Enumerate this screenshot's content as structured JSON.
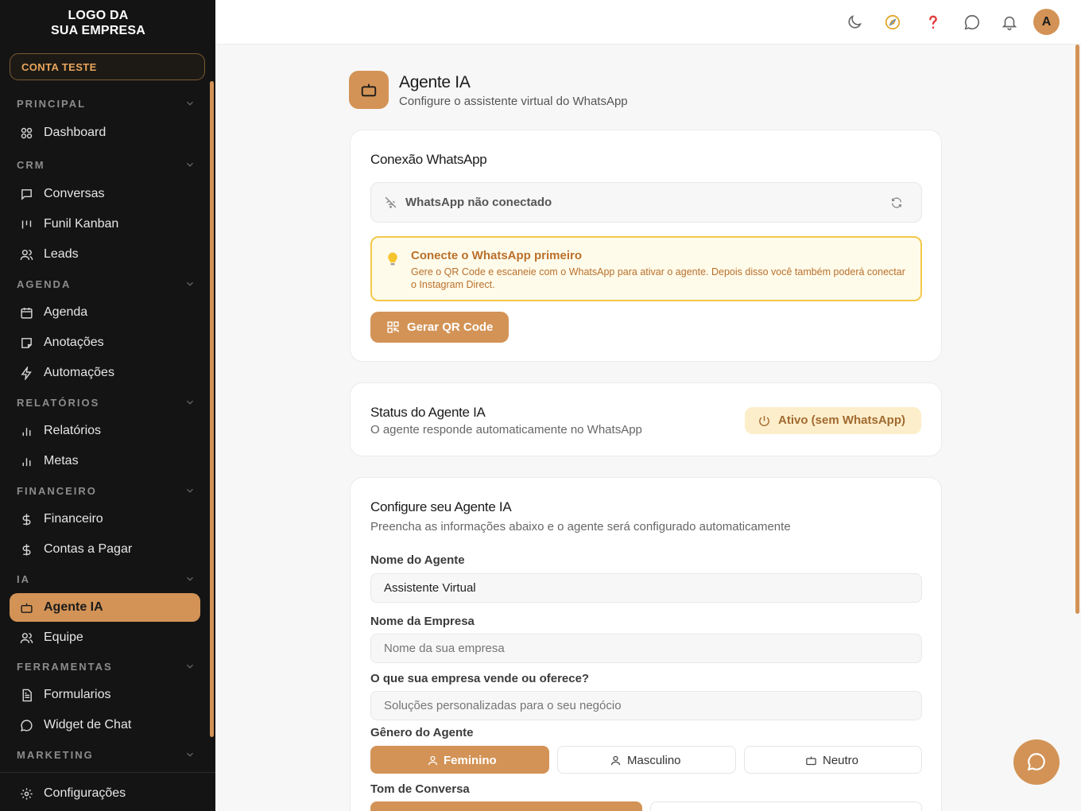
{
  "brand": {
    "logo_line1": "LOGO DA",
    "logo_line2": "SUA EMPRESA",
    "account": "CONTA TESTE",
    "accent": "#d39356"
  },
  "sidebar": {
    "sections": {
      "principal": "PRINCIPAL",
      "crm": "CRM",
      "agenda": "AGENDA",
      "relatorios": "RELATÓRIOS",
      "financeiro": "FINANCEIRO",
      "ia": "IA",
      "ferramentas": "FERRAMENTAS",
      "marketing": "MARKETING"
    },
    "items": {
      "dashboard": "Dashboard",
      "conversas": "Conversas",
      "funil": "Funil Kanban",
      "leads": "Leads",
      "agenda": "Agenda",
      "anotacoes": "Anotações",
      "automacoes": "Automações",
      "relatorios": "Relatórios",
      "metas": "Metas",
      "financeiro": "Financeiro",
      "contas": "Contas a Pagar",
      "agente": "Agente IA",
      "equipe": "Equipe",
      "formularios": "Formularios",
      "widget": "Widget de Chat",
      "configuracoes": "Configurações"
    },
    "active_item": "Agente IA"
  },
  "topbar": {
    "icons": [
      "moon-icon",
      "compass-icon",
      "help-icon",
      "message-icon",
      "bell-icon"
    ],
    "avatar_initial": "A"
  },
  "page": {
    "title": "Agente IA",
    "subtitle": "Configure o assistente virtual do WhatsApp"
  },
  "whatsapp": {
    "title": "Conexão WhatsApp",
    "status": "WhatsApp não conectado",
    "alert_title": "Conecte o WhatsApp primeiro",
    "alert_text": "Gere o QR Code e escaneie com o WhatsApp para ativar o agente. Depois disso você também poderá conectar o Instagram Direct.",
    "button": "Gerar QR Code"
  },
  "agent_status": {
    "title": "Status do Agente IA",
    "subtitle": "O agente responde automaticamente no WhatsApp",
    "badge": "Ativo (sem WhatsApp)"
  },
  "config": {
    "title": "Configure seu Agente IA",
    "subtitle": "Preencha as informações abaixo e o agente será configurado automaticamente",
    "agent_name_label": "Nome do Agente",
    "agent_name_value": "Assistente Virtual",
    "company_label": "Nome da Empresa",
    "company_placeholder": "Nome da sua empresa",
    "offer_label": "O que sua empresa vende ou oferece?",
    "offer_placeholder": "Soluções personalizadas para o seu negócio",
    "gender_label": "Gênero do Agente",
    "gender_options": {
      "fem": "Feminino",
      "masc": "Masculino",
      "neutro": "Neutro"
    },
    "gender_selected": "Feminino",
    "tone_label": "Tom de Conversa"
  }
}
